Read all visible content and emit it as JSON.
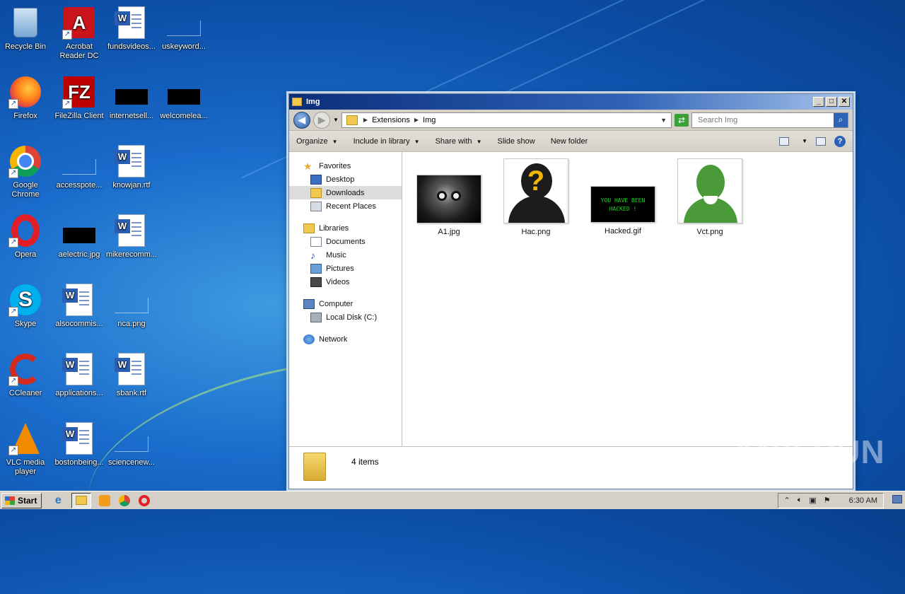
{
  "desktop": {
    "icons": [
      {
        "label": "Recycle Bin"
      },
      {
        "label": "Acrobat Reader DC"
      },
      {
        "label": "fundsvideos..."
      },
      {
        "label": "uskeyword..."
      },
      {
        "label": "Firefox"
      },
      {
        "label": "FileZilla Client"
      },
      {
        "label": "internetsell..."
      },
      {
        "label": "welcomelea..."
      },
      {
        "label": "Google Chrome"
      },
      {
        "label": "accesspote..."
      },
      {
        "label": "knowjan.rtf"
      },
      {
        "label": "Opera"
      },
      {
        "label": "aelectric.jpg"
      },
      {
        "label": "mikerecomm..."
      },
      {
        "label": "Skype"
      },
      {
        "label": "alsocommis..."
      },
      {
        "label": "nca.png"
      },
      {
        "label": "CCleaner"
      },
      {
        "label": "applications..."
      },
      {
        "label": "sbank.rtf"
      },
      {
        "label": "VLC media player"
      },
      {
        "label": "bostonbeing..."
      },
      {
        "label": "sciencenew..."
      }
    ]
  },
  "window": {
    "title": "Img",
    "controls": {
      "minimize": "_",
      "maximize": "□",
      "close": "✕"
    },
    "address": {
      "crumbs": [
        "Extensions",
        "Img"
      ]
    },
    "search": {
      "placeholder": "Search Img"
    },
    "toolbar": {
      "organize": "Organize",
      "include_in_library": "Include in library",
      "share_with": "Share with",
      "slide_show": "Slide show",
      "new_folder": "New folder"
    },
    "nav": {
      "favorites": "Favorites",
      "desktop": "Desktop",
      "downloads": "Downloads",
      "recent_places": "Recent Places",
      "libraries": "Libraries",
      "documents": "Documents",
      "music": "Music",
      "pictures": "Pictures",
      "videos": "Videos",
      "computer": "Computer",
      "local_disk": "Local Disk (C:)",
      "network": "Network"
    },
    "files": [
      {
        "name": "A1.jpg"
      },
      {
        "name": "Hac.png"
      },
      {
        "name": "Hacked.gif",
        "thumb_text": "YOU HAVE BEEN HACKED !"
      },
      {
        "name": "Vct.png"
      }
    ],
    "details": {
      "count": "4 items"
    }
  },
  "taskbar": {
    "start_label": "Start",
    "clock": "6:30 AM"
  },
  "watermark": "ANY RUN",
  "colors": {
    "desktop_bg": "#1a6ccc",
    "title_bar": "#0b2d7a",
    "chrome": "#d4d0c8",
    "selection": "#dcdcdc"
  }
}
